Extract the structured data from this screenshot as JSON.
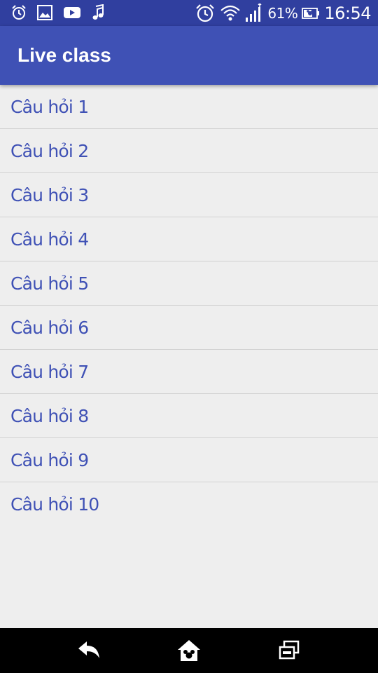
{
  "status_bar": {
    "battery_percent": "61%",
    "time": "16:54",
    "left_icons": [
      "alarm-icon",
      "image-icon",
      "youtube-icon",
      "music-note-icon"
    ],
    "right_icons": [
      "alarm-clock-icon",
      "wifi-icon",
      "signal-icon",
      "battery-icon"
    ]
  },
  "app_bar": {
    "title": "Live class"
  },
  "list": {
    "items": [
      {
        "label": "Câu hỏi 1"
      },
      {
        "label": "Câu hỏi 2"
      },
      {
        "label": "Câu hỏi 3"
      },
      {
        "label": "Câu hỏi 4"
      },
      {
        "label": "Câu hỏi 5"
      },
      {
        "label": "Câu hỏi 6"
      },
      {
        "label": "Câu hỏi 7"
      },
      {
        "label": "Câu hỏi 8"
      },
      {
        "label": "Câu hỏi 9"
      },
      {
        "label": "Câu hỏi 10"
      }
    ]
  },
  "nav_bar": {
    "buttons": [
      "back-icon",
      "home-icon",
      "recent-apps-icon"
    ]
  },
  "colors": {
    "status_bar": "#303f9f",
    "app_bar": "#3f51b5",
    "accent_text": "#3f51b5",
    "background": "#eeeeee"
  }
}
